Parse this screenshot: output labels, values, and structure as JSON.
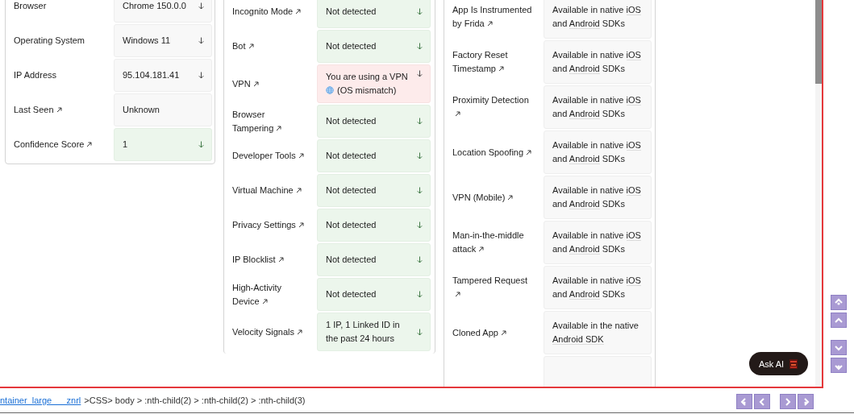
{
  "identity_card": {
    "rows": [
      {
        "label": "Browser",
        "link": false,
        "value": "Chrome 150.0.0",
        "kind": "neutral",
        "expandable": true
      },
      {
        "label": "Operating System",
        "link": false,
        "value": "Windows 11",
        "kind": "neutral",
        "expandable": true
      },
      {
        "label": "IP Address",
        "link": false,
        "value": "95.104.181.41",
        "kind": "neutral",
        "expandable": true
      },
      {
        "label": "Last Seen",
        "link": true,
        "value": "Unknown",
        "kind": "neutral",
        "expandable": false
      },
      {
        "label": "Confidence Score",
        "link": true,
        "value": "1",
        "kind": "ok",
        "expandable": true
      }
    ]
  },
  "signals_card": {
    "rows": [
      {
        "label": "Incognito Mode",
        "link": true,
        "value": "Not detected",
        "kind": "ok",
        "expandable": true,
        "has_icon": false
      },
      {
        "label": "Bot",
        "link": true,
        "value": "Not detected",
        "kind": "ok",
        "expandable": true,
        "has_icon": false
      },
      {
        "label": "VPN",
        "link": true,
        "value": "You are using a VPN",
        "note": "(OS mismatch)",
        "kind": "warning",
        "expandable": true,
        "has_icon": true
      },
      {
        "label": "Browser Tampering",
        "link": true,
        "value": "Not detected",
        "kind": "ok",
        "expandable": true,
        "has_icon": false
      },
      {
        "label": "Developer Tools",
        "link": true,
        "value": "Not detected",
        "kind": "ok",
        "expandable": true,
        "has_icon": false
      },
      {
        "label": "Virtual Machine",
        "link": true,
        "value": "Not detected",
        "kind": "ok",
        "expandable": true,
        "has_icon": false
      },
      {
        "label": "Privacy Settings",
        "link": true,
        "value": "Not detected",
        "kind": "ok",
        "expandable": true,
        "has_icon": false
      },
      {
        "label": "IP Blocklist",
        "link": true,
        "value": "Not detected",
        "kind": "ok",
        "expandable": true,
        "has_icon": false
      },
      {
        "label": "High-Activity Device",
        "link": true,
        "value": "Not detected",
        "kind": "ok",
        "expandable": true,
        "has_icon": false
      },
      {
        "label": "Velocity Signals",
        "link": true,
        "value": "1 IP, 1 Linked ID in the past 24 hours",
        "kind": "ok",
        "expandable": true,
        "has_icon": false
      }
    ]
  },
  "mobile_card": {
    "rows": [
      {
        "label": "App Is Instrumented by Frida",
        "parts": [
          {
            "text": "Available in native "
          },
          {
            "link": "iOS"
          },
          {
            "text": " and "
          },
          {
            "link": "Android"
          },
          {
            "text": " SDKs"
          }
        ]
      },
      {
        "label": "Factory Reset Timestamp",
        "parts": [
          {
            "text": "Available in native "
          },
          {
            "link": "iOS"
          },
          {
            "text": " and "
          },
          {
            "link": "Android"
          },
          {
            "text": " SDKs"
          }
        ]
      },
      {
        "label": "Proximity Detection",
        "parts": [
          {
            "text": "Available in native "
          },
          {
            "link": "iOS"
          },
          {
            "text": " and "
          },
          {
            "link": "Android"
          },
          {
            "text": " SDKs"
          }
        ]
      },
      {
        "label": "Location Spoofing",
        "parts": [
          {
            "text": "Available in native "
          },
          {
            "link": "iOS"
          },
          {
            "text": " and "
          },
          {
            "link": "Android"
          },
          {
            "text": " SDKs"
          }
        ]
      },
      {
        "label": "VPN (Mobile)",
        "parts": [
          {
            "text": "Available in native "
          },
          {
            "link": "iOS"
          },
          {
            "text": " and "
          },
          {
            "link": "Android"
          },
          {
            "text": " SDKs"
          }
        ]
      },
      {
        "label": "Man-in-the-middle attack",
        "parts": [
          {
            "text": "Available in native "
          },
          {
            "link": "iOS"
          },
          {
            "text": " and "
          },
          {
            "link": "Android"
          },
          {
            "text": " SDKs"
          }
        ]
      },
      {
        "label": "Tampered Request",
        "parts": [
          {
            "text": "Available in native "
          },
          {
            "link": "iOS"
          },
          {
            "text": " and "
          },
          {
            "link": "Android"
          },
          {
            "text": " SDKs"
          }
        ]
      },
      {
        "label": "Cloned App",
        "parts": [
          {
            "text": "Available in the native "
          },
          {
            "link": "Android SDK"
          }
        ]
      }
    ]
  },
  "ask_ai": {
    "label": "Ask AI"
  },
  "status_bar": {
    "link": "ntainer_large___znrl",
    "path": ">CSS> body > :nth-child(2) > :nth-child(2) > :nth-child(3)"
  }
}
